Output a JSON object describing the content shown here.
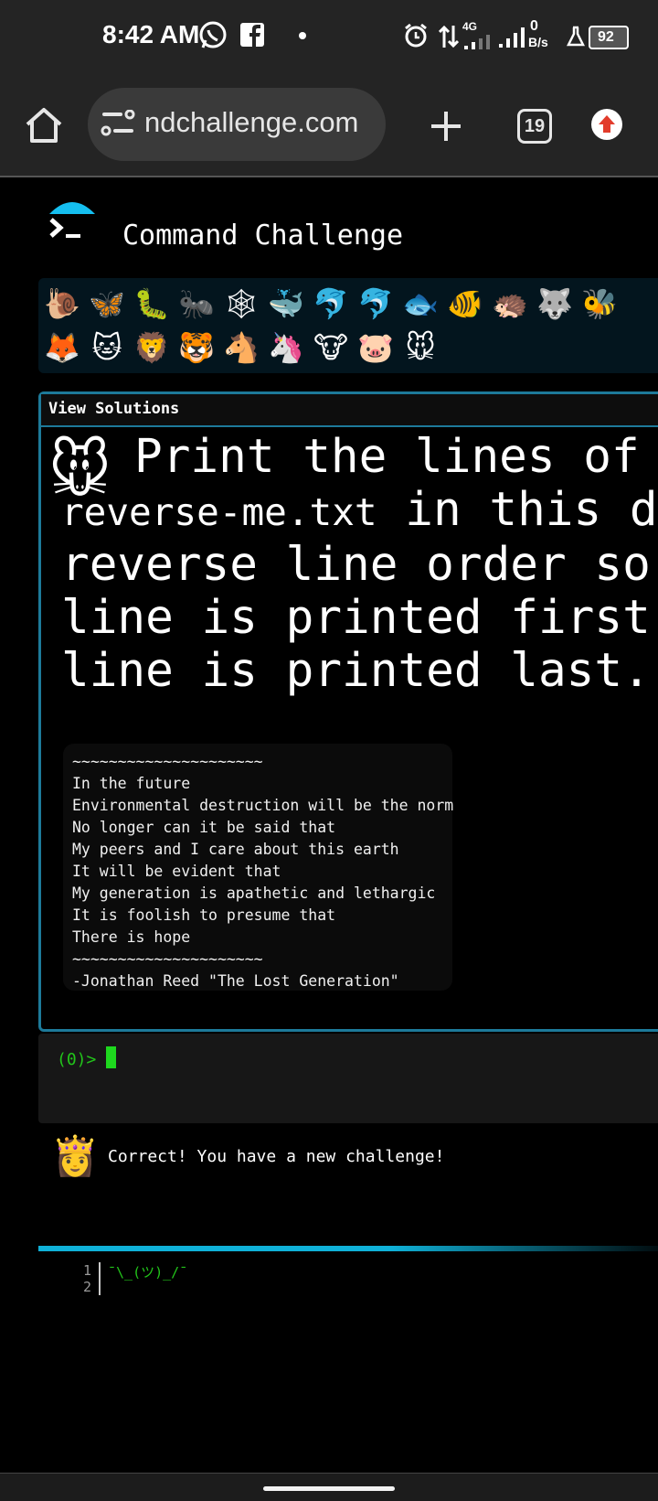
{
  "status_bar": {
    "time": "8:42 AM",
    "network": "4G",
    "speed_value": "0",
    "speed_unit": "B/s",
    "battery": "92"
  },
  "browser": {
    "url": "ndchallenge.com",
    "tab_count": "19",
    "icons": [
      "home-icon",
      "site-settings-icon",
      "new-tab-icon",
      "tabs-icon",
      "update-icon"
    ]
  },
  "site": {
    "title": "Command Challenge"
  },
  "challenge_emojis": [
    {
      "glyph": "🐌",
      "name": "snail"
    },
    {
      "glyph": "🦋",
      "name": "butterfly"
    },
    {
      "glyph": "🐛",
      "name": "caterpillar"
    },
    {
      "glyph": "🐜",
      "name": "ant"
    },
    {
      "glyph": "🕸",
      "name": "spider-web"
    },
    {
      "glyph": "🐳",
      "name": "whale"
    },
    {
      "glyph": "🐬",
      "name": "dolphin"
    },
    {
      "glyph": "🐬",
      "name": "dolphin-2"
    },
    {
      "glyph": "🐟",
      "name": "fish"
    },
    {
      "glyph": "🐠",
      "name": "tropical-fish"
    },
    {
      "glyph": "🦔",
      "name": "hedgehog"
    },
    {
      "glyph": "🐺",
      "name": "wolf"
    },
    {
      "glyph": "🐝",
      "name": "bee"
    },
    {
      "glyph": "🦊",
      "name": "fox"
    },
    {
      "glyph": "🐱",
      "name": "cat"
    },
    {
      "glyph": "🦁",
      "name": "lion"
    },
    {
      "glyph": "🐯",
      "name": "tiger"
    },
    {
      "glyph": "🐴",
      "name": "horse"
    },
    {
      "glyph": "🦄",
      "name": "unicorn"
    },
    {
      "glyph": "🐮",
      "name": "cow"
    },
    {
      "glyph": "🐷",
      "name": "pig"
    },
    {
      "glyph": "🐭",
      "name": "mouse"
    }
  ],
  "solutions": {
    "header": "View Solutions",
    "emoji": "🐭",
    "text_line1": "Print the lines of",
    "text_line2_file": "reverse-me.txt",
    "text_line2_rest": " in this d",
    "text_line3": "reverse line order so",
    "text_line4": "line is printed first",
    "text_line5": "line is printed last."
  },
  "poem_lines": [
    "~~~~~~~~~~~~~~~~~~~~~",
    "In the future",
    "Environmental destruction will be the norm",
    "No longer can it be said that",
    "My peers and I care about this earth",
    "It will be evident that",
    "My generation is apathetic and lethargic",
    "It is foolish to presume that",
    "There is hope",
    "~~~~~~~~~~~~~~~~~~~~~",
    "-Jonathan Reed \"The Lost Generation\""
  ],
  "terminal": {
    "prompt": "(0)>"
  },
  "feedback": {
    "emoji": "👸",
    "message": "Correct! You have a new challenge!"
  },
  "editor": {
    "line_numbers": [
      "1",
      "2"
    ],
    "code": "¯\\_(ツ)_/¯"
  }
}
